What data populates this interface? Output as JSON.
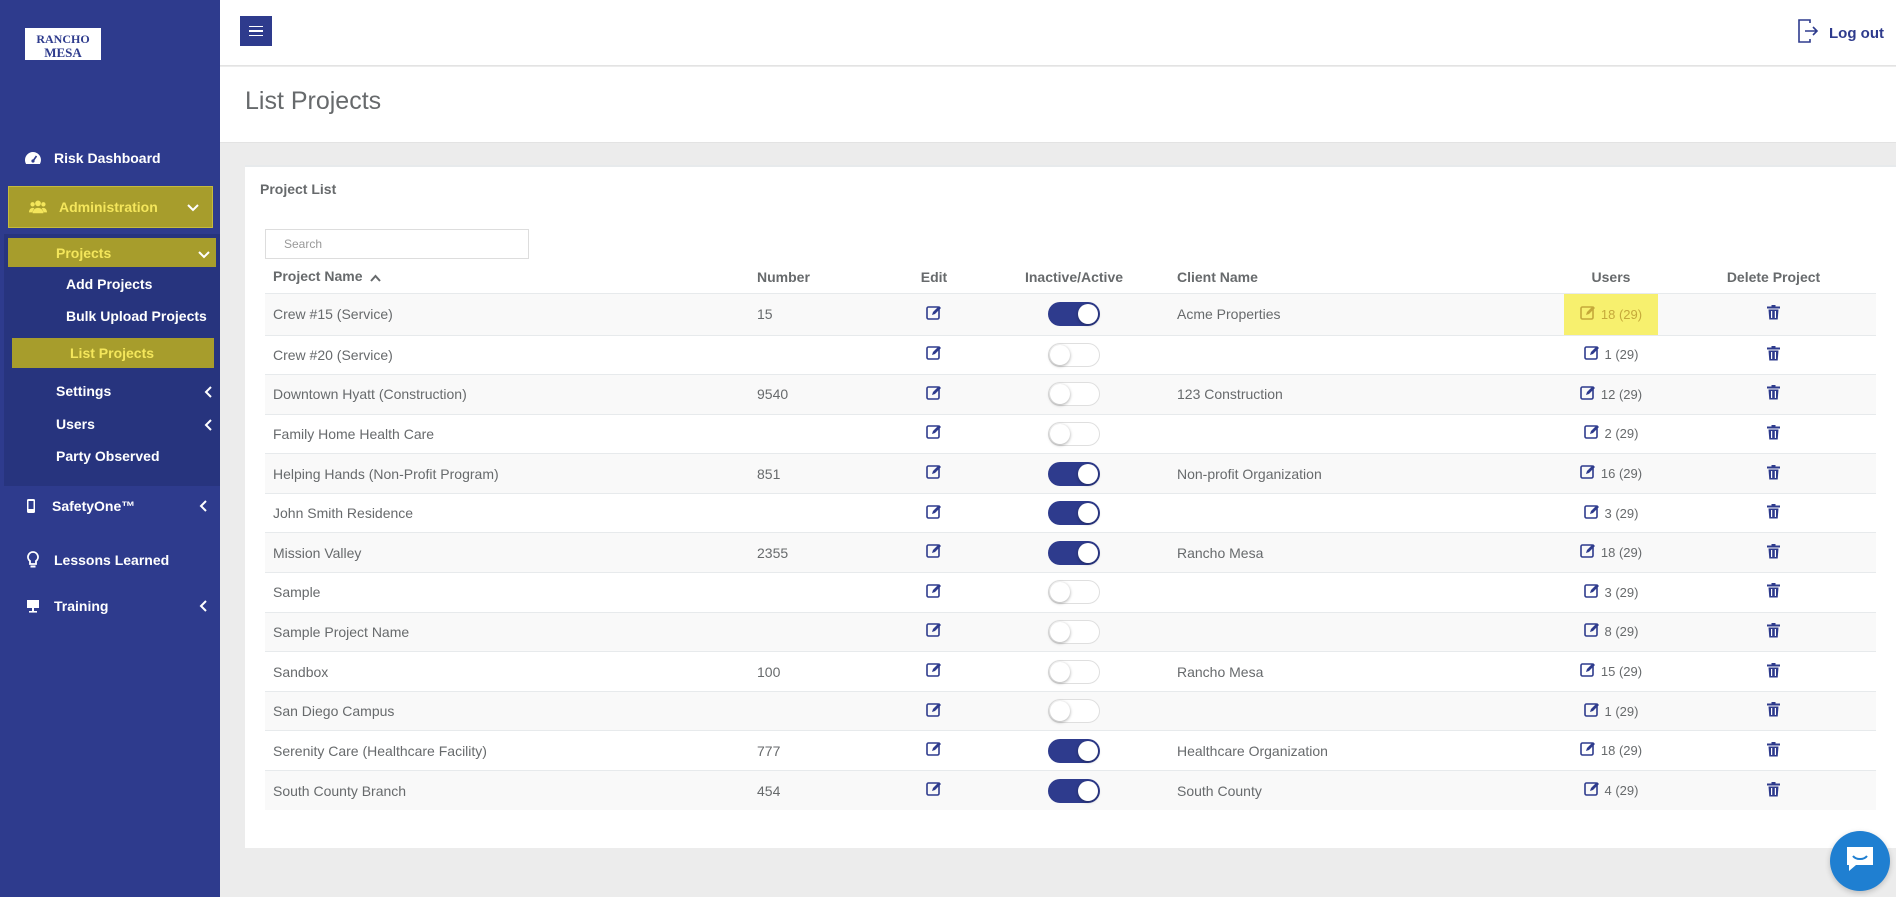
{
  "app": {
    "logo_text_1": "RANCHO",
    "logo_text_2": "MESA"
  },
  "sidebar": {
    "risk_dashboard": "Risk Dashboard",
    "administration": "Administration",
    "projects": "Projects",
    "add_projects": "Add Projects",
    "bulk_upload": "Bulk Upload Projects",
    "list_projects": "List Projects",
    "settings": "Settings",
    "users": "Users",
    "party_observed": "Party Observed",
    "safetyone": "SafetyOne™",
    "lessons_learned": "Lessons Learned",
    "training": "Training"
  },
  "topbar": {
    "logout_label": "Log out"
  },
  "page": {
    "title": "List Projects",
    "card_title": "Project List"
  },
  "search": {
    "placeholder": "Search",
    "value": ""
  },
  "table": {
    "headers": {
      "name": "Project Name",
      "number": "Number",
      "edit": "Edit",
      "active": "Inactive/Active",
      "client": "Client Name",
      "users": "Users",
      "delete": "Delete Project"
    },
    "rows": [
      {
        "name": "Crew #15 (Service)",
        "number": "15",
        "active": true,
        "client": "Acme Properties",
        "users": "18 (29)",
        "highlight": true
      },
      {
        "name": "Crew #20 (Service)",
        "number": "",
        "active": false,
        "client": "",
        "users": "1 (29)"
      },
      {
        "name": "Downtown Hyatt (Construction)",
        "number": "9540",
        "active": false,
        "client": "123 Construction",
        "users": "12 (29)"
      },
      {
        "name": "Family Home Health Care",
        "number": "",
        "active": false,
        "client": "",
        "users": "2 (29)"
      },
      {
        "name": "Helping Hands (Non-Profit Program)",
        "number": "851",
        "active": true,
        "client": "Non-profit Organization",
        "users": "16 (29)"
      },
      {
        "name": "John Smith Residence",
        "number": "",
        "active": true,
        "client": "",
        "users": "3 (29)"
      },
      {
        "name": "Mission Valley",
        "number": "2355",
        "active": true,
        "client": "Rancho Mesa",
        "users": "18 (29)"
      },
      {
        "name": "Sample",
        "number": "",
        "active": false,
        "client": "",
        "users": "3 (29)"
      },
      {
        "name": "Sample Project Name",
        "number": "",
        "active": false,
        "client": "",
        "users": "8 (29)"
      },
      {
        "name": "Sandbox",
        "number": "100",
        "active": false,
        "client": "Rancho Mesa",
        "users": "15 (29)"
      },
      {
        "name": "San Diego Campus",
        "number": "",
        "active": false,
        "client": "",
        "users": "1 (29)"
      },
      {
        "name": "Serenity Care (Healthcare Facility)",
        "number": "777",
        "active": true,
        "client": "Healthcare Organization",
        "users": "18 (29)"
      },
      {
        "name": "South County Branch",
        "number": "454",
        "active": true,
        "client": "South County",
        "users": "4 (29)"
      }
    ]
  },
  "colors": {
    "brand": "#2e3b8d",
    "accent": "#a79d2c",
    "highlight": "#f7f06e"
  }
}
